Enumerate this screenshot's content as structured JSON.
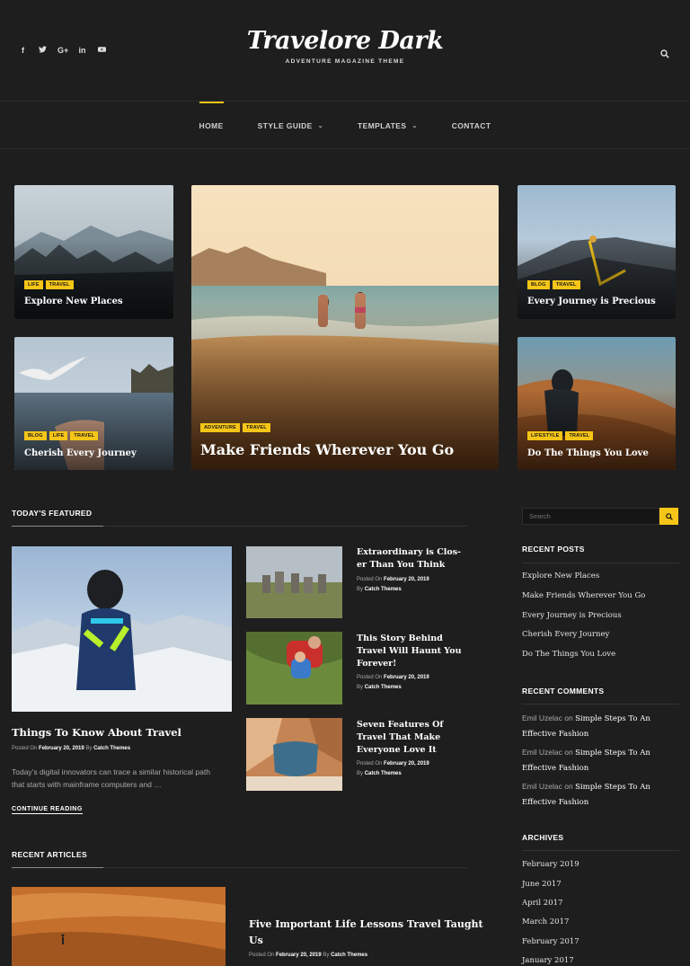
{
  "header": {
    "logo": "Travelore Dark",
    "tagline": "ADVENTURE MAGAZINE THEME",
    "social": [
      "f",
      "t",
      "G+",
      "in",
      "yt"
    ]
  },
  "nav": {
    "items": [
      {
        "label": "HOME",
        "active": true,
        "has_submenu": false
      },
      {
        "label": "STYLE GUIDE",
        "active": false,
        "has_submenu": true
      },
      {
        "label": "TEMPLATES",
        "active": false,
        "has_submenu": true
      },
      {
        "label": "CONTACT",
        "active": false,
        "has_submenu": false
      }
    ]
  },
  "hero": {
    "tile1": {
      "tags": [
        "LIFE",
        "TRAVEL"
      ],
      "title": "Explore New Places"
    },
    "tile2": {
      "tags": [
        "ADVENTURE",
        "TRAVEL"
      ],
      "title": "Make Friends Wherever You Go"
    },
    "tile3": {
      "tags": [
        "BLOG",
        "TRAVEL"
      ],
      "title": "Every Journey is Precious"
    },
    "tile4": {
      "tags": [
        "BLOG",
        "LIFE",
        "TRAVEL"
      ],
      "title": "Cherish Every Journey"
    },
    "tile5": {
      "tags": [
        "LIFESTYLE",
        "TRAVEL"
      ],
      "title": "Do The Things You Love"
    }
  },
  "featured": {
    "heading": "TODAY'S FEATURED",
    "main": {
      "title": "Things To Know About Travel",
      "posted_on": "Posted On",
      "date": "February 20, 2019",
      "by": "By",
      "author": "Catch Themes",
      "excerpt_line1": "Today’s digital innovators can trace a similar historical path",
      "excerpt_line2": "that starts with mainframe computers and …",
      "continue": "CONTINUE READING"
    },
    "side_posts": [
      {
        "title_line1": "Extraordinary is Clos-",
        "title_line2": "er Than You Think",
        "title_line3": "",
        "posted_on": "Posted On",
        "date": "February 20, 2019",
        "by": "By",
        "author": "Catch Themes"
      },
      {
        "title_line1": "This Story Behind",
        "title_line2": "Travel Will Haunt You",
        "title_line3": "Forever!",
        "posted_on": "Posted On",
        "date": "February 20, 2019",
        "by": "By",
        "author": "Catch Themes"
      },
      {
        "title_line1": "Seven Features Of",
        "title_line2": "Travel That Make",
        "title_line3": "Everyone Love It",
        "posted_on": "Posted On",
        "date": "February 20, 2019",
        "by": "By",
        "author": "Catch Themes"
      }
    ]
  },
  "recent_articles": {
    "heading": "RECENT ARTICLES",
    "post": {
      "title_line1": "Five Important Life Lessons Travel Taught",
      "title_line2": "Us",
      "posted_on": "Posted On",
      "date": "February 20, 2019",
      "by": "By",
      "author": "Catch Themes"
    }
  },
  "sidebar": {
    "search_placeholder": "Search",
    "recent_posts_heading": "RECENT POSTS",
    "recent_posts": [
      "Explore New Places",
      "Make Friends Wherever You Go",
      "Every Journey is Precious",
      "Cherish Every Journey",
      "Do The Things You Love"
    ],
    "recent_comments_heading": "RECENT COMMENTS",
    "comments": [
      {
        "author": "Emil Uzelac",
        "on": "on",
        "link": "Simple Steps To An Effective Fashion"
      },
      {
        "author": "Emil Uzelac",
        "on": "on",
        "link": "Simple Steps To An Effective Fashion"
      },
      {
        "author": "Emil Uzelac",
        "on": "on",
        "link": "Simple Steps To An Effective Fashion"
      }
    ],
    "archives_heading": "ARCHIVES",
    "archives": [
      "February 2019",
      "June 2017",
      "April 2017",
      "March 2017",
      "February 2017",
      "January 2017"
    ]
  },
  "colors": {
    "accent": "#f5c518",
    "background": "#1e1e1e"
  }
}
